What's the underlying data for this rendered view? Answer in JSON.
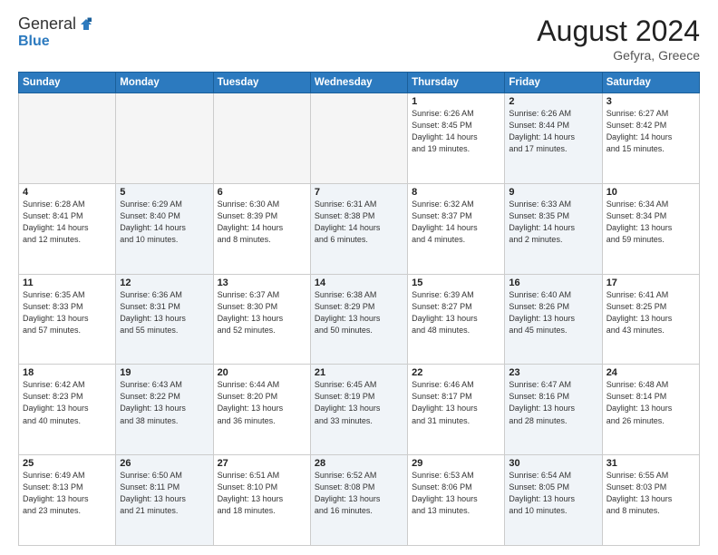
{
  "header": {
    "logo_general": "General",
    "logo_blue": "Blue",
    "month_year": "August 2024",
    "location": "Gefyra, Greece"
  },
  "days_of_week": [
    "Sunday",
    "Monday",
    "Tuesday",
    "Wednesday",
    "Thursday",
    "Friday",
    "Saturday"
  ],
  "weeks": [
    [
      {
        "day": "",
        "info": "",
        "empty": true
      },
      {
        "day": "",
        "info": "",
        "empty": true
      },
      {
        "day": "",
        "info": "",
        "empty": true
      },
      {
        "day": "",
        "info": "",
        "empty": true
      },
      {
        "day": "1",
        "info": "Sunrise: 6:26 AM\nSunset: 8:45 PM\nDaylight: 14 hours\nand 19 minutes.",
        "empty": false,
        "shaded": false
      },
      {
        "day": "2",
        "info": "Sunrise: 6:26 AM\nSunset: 8:44 PM\nDaylight: 14 hours\nand 17 minutes.",
        "empty": false,
        "shaded": true
      },
      {
        "day": "3",
        "info": "Sunrise: 6:27 AM\nSunset: 8:42 PM\nDaylight: 14 hours\nand 15 minutes.",
        "empty": false,
        "shaded": false
      }
    ],
    [
      {
        "day": "4",
        "info": "Sunrise: 6:28 AM\nSunset: 8:41 PM\nDaylight: 14 hours\nand 12 minutes.",
        "empty": false,
        "shaded": false
      },
      {
        "day": "5",
        "info": "Sunrise: 6:29 AM\nSunset: 8:40 PM\nDaylight: 14 hours\nand 10 minutes.",
        "empty": false,
        "shaded": true
      },
      {
        "day": "6",
        "info": "Sunrise: 6:30 AM\nSunset: 8:39 PM\nDaylight: 14 hours\nand 8 minutes.",
        "empty": false,
        "shaded": false
      },
      {
        "day": "7",
        "info": "Sunrise: 6:31 AM\nSunset: 8:38 PM\nDaylight: 14 hours\nand 6 minutes.",
        "empty": false,
        "shaded": true
      },
      {
        "day": "8",
        "info": "Sunrise: 6:32 AM\nSunset: 8:37 PM\nDaylight: 14 hours\nand 4 minutes.",
        "empty": false,
        "shaded": false
      },
      {
        "day": "9",
        "info": "Sunrise: 6:33 AM\nSunset: 8:35 PM\nDaylight: 14 hours\nand 2 minutes.",
        "empty": false,
        "shaded": true
      },
      {
        "day": "10",
        "info": "Sunrise: 6:34 AM\nSunset: 8:34 PM\nDaylight: 13 hours\nand 59 minutes.",
        "empty": false,
        "shaded": false
      }
    ],
    [
      {
        "day": "11",
        "info": "Sunrise: 6:35 AM\nSunset: 8:33 PM\nDaylight: 13 hours\nand 57 minutes.",
        "empty": false,
        "shaded": false
      },
      {
        "day": "12",
        "info": "Sunrise: 6:36 AM\nSunset: 8:31 PM\nDaylight: 13 hours\nand 55 minutes.",
        "empty": false,
        "shaded": true
      },
      {
        "day": "13",
        "info": "Sunrise: 6:37 AM\nSunset: 8:30 PM\nDaylight: 13 hours\nand 52 minutes.",
        "empty": false,
        "shaded": false
      },
      {
        "day": "14",
        "info": "Sunrise: 6:38 AM\nSunset: 8:29 PM\nDaylight: 13 hours\nand 50 minutes.",
        "empty": false,
        "shaded": true
      },
      {
        "day": "15",
        "info": "Sunrise: 6:39 AM\nSunset: 8:27 PM\nDaylight: 13 hours\nand 48 minutes.",
        "empty": false,
        "shaded": false
      },
      {
        "day": "16",
        "info": "Sunrise: 6:40 AM\nSunset: 8:26 PM\nDaylight: 13 hours\nand 45 minutes.",
        "empty": false,
        "shaded": true
      },
      {
        "day": "17",
        "info": "Sunrise: 6:41 AM\nSunset: 8:25 PM\nDaylight: 13 hours\nand 43 minutes.",
        "empty": false,
        "shaded": false
      }
    ],
    [
      {
        "day": "18",
        "info": "Sunrise: 6:42 AM\nSunset: 8:23 PM\nDaylight: 13 hours\nand 40 minutes.",
        "empty": false,
        "shaded": false
      },
      {
        "day": "19",
        "info": "Sunrise: 6:43 AM\nSunset: 8:22 PM\nDaylight: 13 hours\nand 38 minutes.",
        "empty": false,
        "shaded": true
      },
      {
        "day": "20",
        "info": "Sunrise: 6:44 AM\nSunset: 8:20 PM\nDaylight: 13 hours\nand 36 minutes.",
        "empty": false,
        "shaded": false
      },
      {
        "day": "21",
        "info": "Sunrise: 6:45 AM\nSunset: 8:19 PM\nDaylight: 13 hours\nand 33 minutes.",
        "empty": false,
        "shaded": true
      },
      {
        "day": "22",
        "info": "Sunrise: 6:46 AM\nSunset: 8:17 PM\nDaylight: 13 hours\nand 31 minutes.",
        "empty": false,
        "shaded": false
      },
      {
        "day": "23",
        "info": "Sunrise: 6:47 AM\nSunset: 8:16 PM\nDaylight: 13 hours\nand 28 minutes.",
        "empty": false,
        "shaded": true
      },
      {
        "day": "24",
        "info": "Sunrise: 6:48 AM\nSunset: 8:14 PM\nDaylight: 13 hours\nand 26 minutes.",
        "empty": false,
        "shaded": false
      }
    ],
    [
      {
        "day": "25",
        "info": "Sunrise: 6:49 AM\nSunset: 8:13 PM\nDaylight: 13 hours\nand 23 minutes.",
        "empty": false,
        "shaded": false
      },
      {
        "day": "26",
        "info": "Sunrise: 6:50 AM\nSunset: 8:11 PM\nDaylight: 13 hours\nand 21 minutes.",
        "empty": false,
        "shaded": true
      },
      {
        "day": "27",
        "info": "Sunrise: 6:51 AM\nSunset: 8:10 PM\nDaylight: 13 hours\nand 18 minutes.",
        "empty": false,
        "shaded": false
      },
      {
        "day": "28",
        "info": "Sunrise: 6:52 AM\nSunset: 8:08 PM\nDaylight: 13 hours\nand 16 minutes.",
        "empty": false,
        "shaded": true
      },
      {
        "day": "29",
        "info": "Sunrise: 6:53 AM\nSunset: 8:06 PM\nDaylight: 13 hours\nand 13 minutes.",
        "empty": false,
        "shaded": false
      },
      {
        "day": "30",
        "info": "Sunrise: 6:54 AM\nSunset: 8:05 PM\nDaylight: 13 hours\nand 10 minutes.",
        "empty": false,
        "shaded": true
      },
      {
        "day": "31",
        "info": "Sunrise: 6:55 AM\nSunset: 8:03 PM\nDaylight: 13 hours\nand 8 minutes.",
        "empty": false,
        "shaded": false
      }
    ]
  ]
}
